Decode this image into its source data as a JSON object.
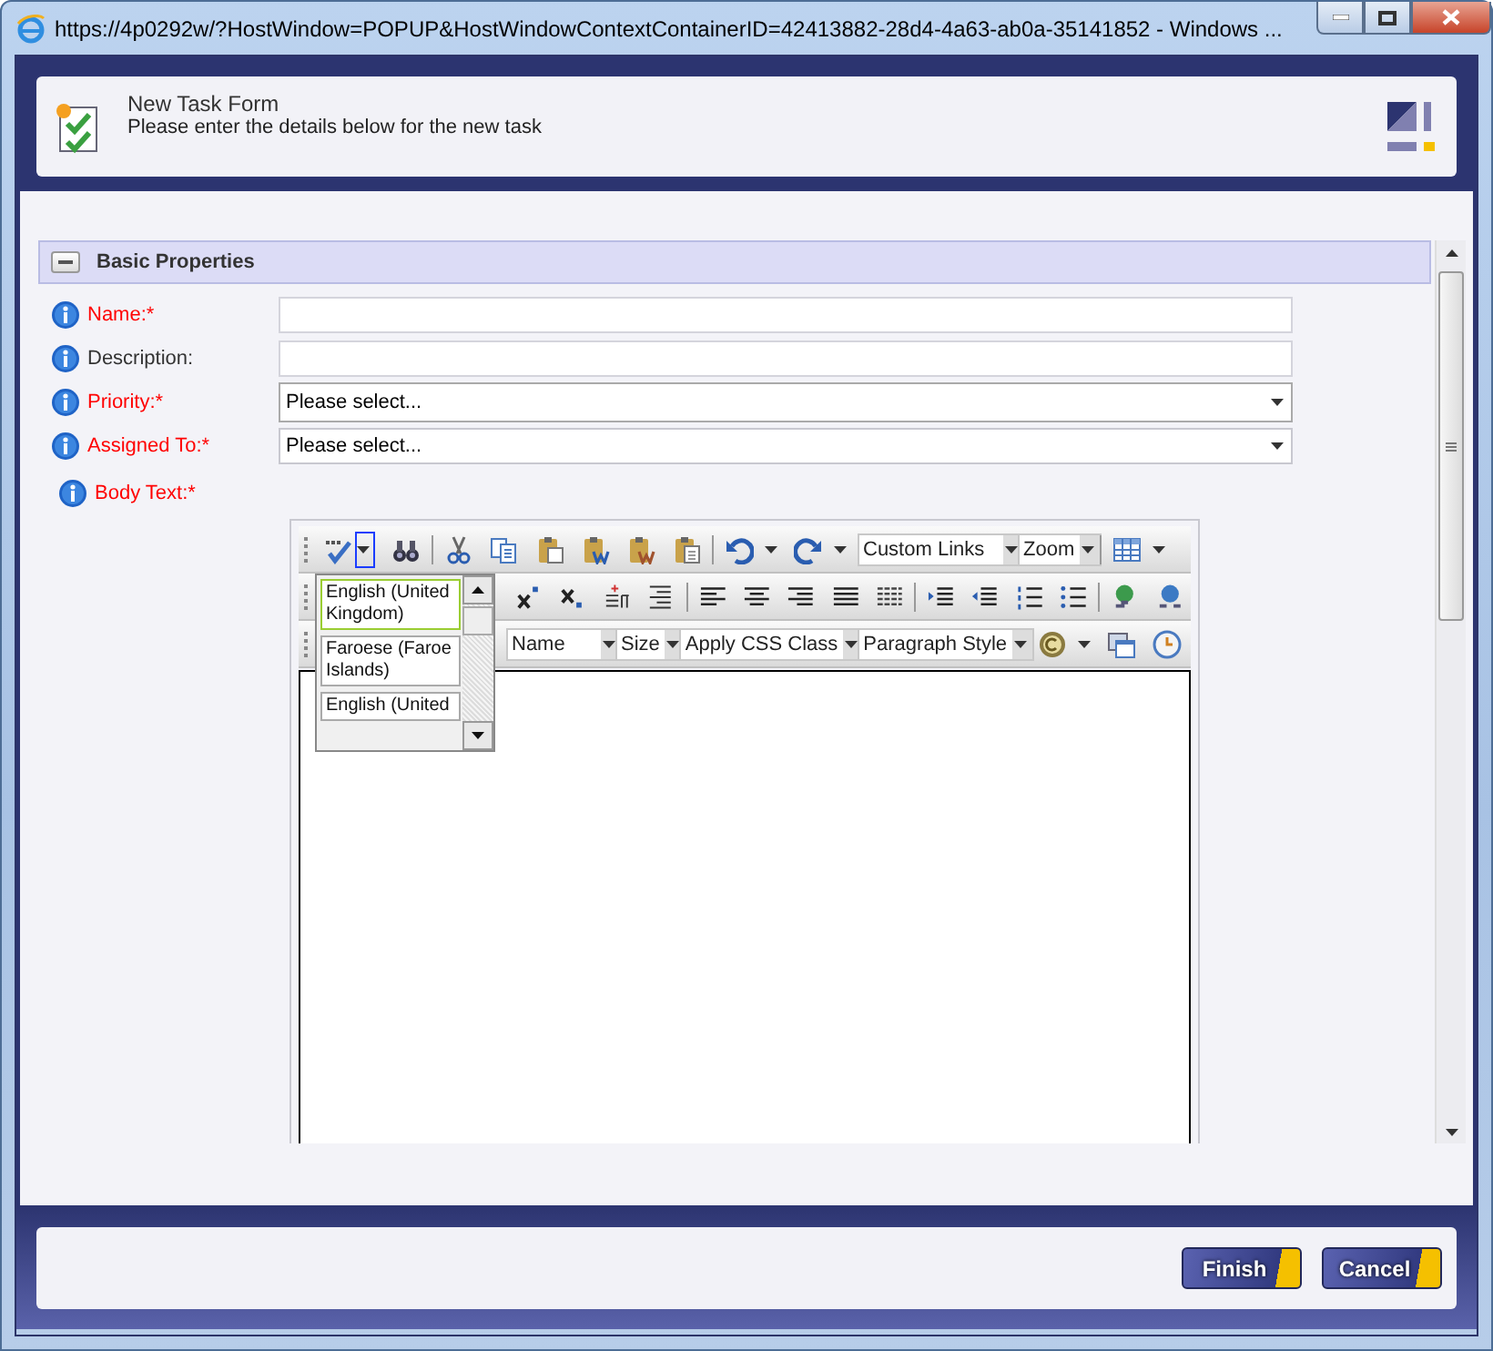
{
  "window": {
    "title": "https://4p0292w/?HostWindow=POPUP&HostWindowContextContainerID=42413882-28d4-4a63-ab0a-35141852 - Windows ..."
  },
  "header": {
    "title": "New Task Form",
    "subtitle": "Please enter the details below for the new task"
  },
  "section": {
    "title": "Basic Properties",
    "expanded": true
  },
  "fields": [
    {
      "kind": "text",
      "label": "Name:*",
      "required": true
    },
    {
      "kind": "text",
      "label": "Description:",
      "required": false
    },
    {
      "kind": "select",
      "label": "Priority:*",
      "required": true,
      "value": "Please select..."
    },
    {
      "kind": "select",
      "label": "Assigned To:*",
      "required": true,
      "value": "Please select..."
    },
    {
      "kind": "editor",
      "label": "Body Text:*",
      "required": true
    }
  ],
  "editor": {
    "row1_dropdowns": [
      "Custom Links",
      "Zoom"
    ],
    "row3_dropdowns": [
      "Name",
      "Size",
      "Apply CSS Class",
      "Paragraph Style"
    ],
    "spell_menu": {
      "open": true,
      "items": [
        {
          "label": "English (United Kingdom)",
          "selected": true
        },
        {
          "label": "Faroese (Faroe Islands)",
          "selected": false
        },
        {
          "label": "English (United",
          "selected": false
        }
      ]
    }
  },
  "buttons": [
    {
      "label": "Finish"
    },
    {
      "label": "Cancel"
    }
  ]
}
